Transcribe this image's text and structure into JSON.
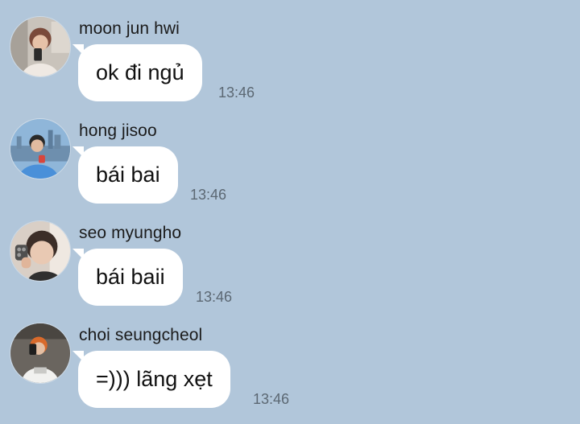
{
  "colors": {
    "background": "#b1c6da",
    "bubble": "#ffffff",
    "name_text": "#1b1b1b",
    "time_text": "#5c6873"
  },
  "messages": [
    {
      "sender": "moon jun hwi",
      "text": "ok đi ngủ",
      "time": "13:46",
      "avatar_icon": "user-avatar-mirror-selfie"
    },
    {
      "sender": "hong jisoo",
      "text": "bái bai",
      "time": "13:46",
      "avatar_icon": "user-avatar-city-skyline"
    },
    {
      "sender": "seo myungho",
      "text": "bái baii",
      "time": "13:46",
      "avatar_icon": "user-avatar-portrait"
    },
    {
      "sender": "choi seungcheol",
      "text": "=))) lãng xẹt",
      "time": "13:46",
      "avatar_icon": "user-avatar-selfie"
    }
  ]
}
